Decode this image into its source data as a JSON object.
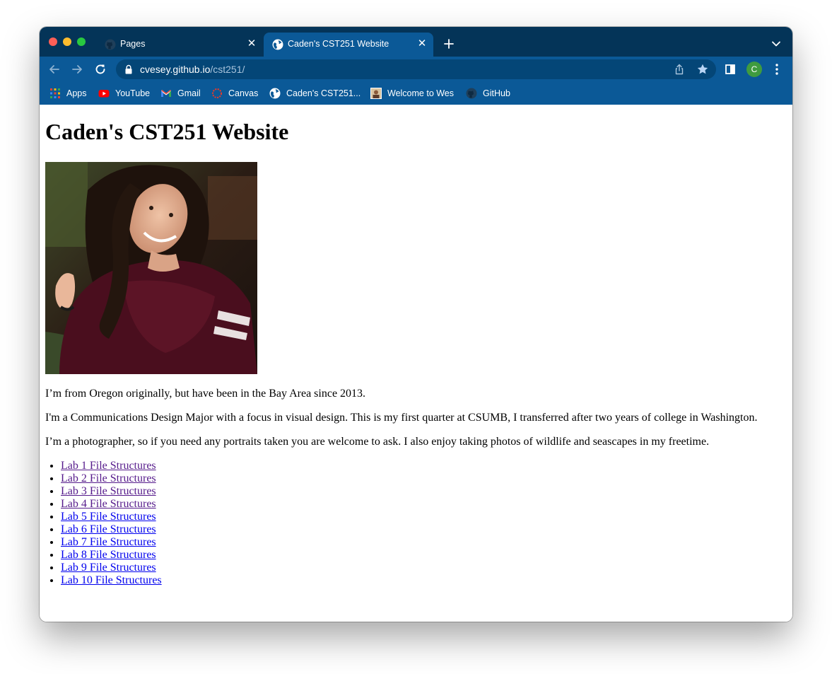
{
  "browser": {
    "tabs": [
      {
        "title": "Pages",
        "icon": "github-icon",
        "active": false
      },
      {
        "title": "Caden's CST251 Website",
        "icon": "globe-icon",
        "active": true
      }
    ],
    "url": {
      "host": "cvesey.github.io",
      "path": "/cst251/"
    },
    "profile_initial": "C",
    "accent_colors": {
      "frame": "#043458",
      "toolbar": "#0b5997",
      "omnibox": "#044677",
      "avatar": "#3f9b3f"
    }
  },
  "bookmarks": [
    {
      "label": "Apps",
      "icon": "apps-grid-icon"
    },
    {
      "label": "YouTube",
      "icon": "youtube-icon"
    },
    {
      "label": "Gmail",
      "icon": "gmail-icon"
    },
    {
      "label": "Canvas",
      "icon": "canvas-icon"
    },
    {
      "label": "Caden's CST251...",
      "icon": "globe-icon"
    },
    {
      "label": "Welcome to Wes",
      "icon": "site-thumbnail-icon"
    },
    {
      "label": "GitHub",
      "icon": "github-icon"
    }
  ],
  "page": {
    "heading": "Caden's CST251 Website",
    "paragraphs": [
      "I’m from Oregon originally, but have been in the Bay Area since 2013.",
      "I'm a Communications Design Major with a focus in visual design. This is my first quarter at CSUMB, I transferred after two years of college in Washington.",
      "I’m a photographer, so if you need any portraits taken you are welcome to ask. I also enjoy taking photos of wildlife and seascapes in my freetime."
    ],
    "links": [
      {
        "label": "Lab 1 File Structures",
        "visited": true
      },
      {
        "label": "Lab 2 File Structures",
        "visited": true
      },
      {
        "label": "Lab 3 File Structures",
        "visited": true
      },
      {
        "label": "Lab 4 File Structures",
        "visited": true
      },
      {
        "label": "Lab 5 File Structures",
        "visited": false
      },
      {
        "label": "Lab 6 File Structures",
        "visited": false
      },
      {
        "label": "Lab 7 File Structures",
        "visited": false
      },
      {
        "label": "Lab 8 File Structures",
        "visited": false
      },
      {
        "label": "Lab 9 File Structures",
        "visited": false
      },
      {
        "label": "Lab 10 File Structures",
        "visited": false
      }
    ],
    "link_colors": {
      "visited": "#551a8b",
      "unvisited": "#0000ee"
    }
  }
}
